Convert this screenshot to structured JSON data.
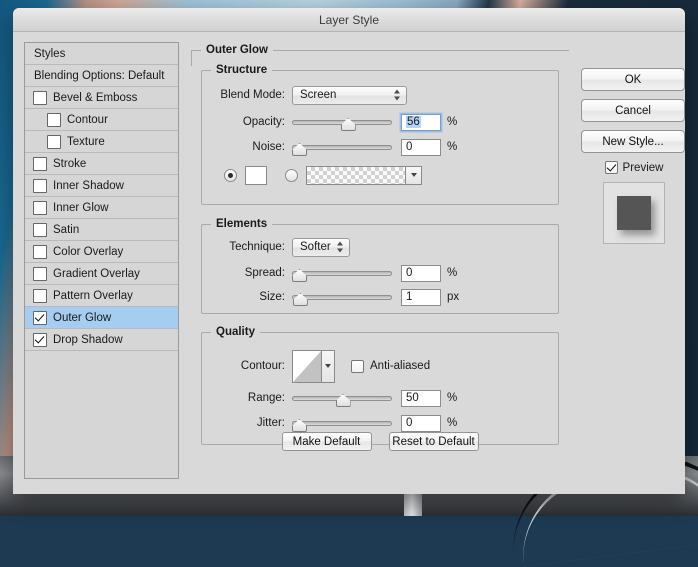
{
  "window": {
    "title": "Layer Style"
  },
  "styles_panel": {
    "header_label": "Styles",
    "blending_options_label": "Blending Options: Default",
    "items": [
      {
        "label": "Bevel & Emboss",
        "checked": false,
        "indent": false,
        "selected": false
      },
      {
        "label": "Contour",
        "checked": false,
        "indent": true,
        "selected": false
      },
      {
        "label": "Texture",
        "checked": false,
        "indent": true,
        "selected": false
      },
      {
        "label": "Stroke",
        "checked": false,
        "indent": false,
        "selected": false
      },
      {
        "label": "Inner Shadow",
        "checked": false,
        "indent": false,
        "selected": false
      },
      {
        "label": "Inner Glow",
        "checked": false,
        "indent": false,
        "selected": false
      },
      {
        "label": "Satin",
        "checked": false,
        "indent": false,
        "selected": false
      },
      {
        "label": "Color Overlay",
        "checked": false,
        "indent": false,
        "selected": false
      },
      {
        "label": "Gradient Overlay",
        "checked": false,
        "indent": false,
        "selected": false
      },
      {
        "label": "Pattern Overlay",
        "checked": false,
        "indent": false,
        "selected": false
      },
      {
        "label": "Outer Glow",
        "checked": true,
        "indent": false,
        "selected": true
      },
      {
        "label": "Drop Shadow",
        "checked": true,
        "indent": false,
        "selected": false
      }
    ]
  },
  "main_panel": {
    "effect_title": "Outer Glow",
    "structure": {
      "legend": "Structure",
      "blend_mode_label": "Blend Mode:",
      "blend_mode_value": "Screen",
      "opacity_label": "Opacity:",
      "opacity_value": "56",
      "opacity_unit": "%",
      "noise_label": "Noise:",
      "noise_value": "0",
      "noise_unit": "%",
      "fill_type": "color",
      "color_value": "#ffffff"
    },
    "elements": {
      "legend": "Elements",
      "technique_label": "Technique:",
      "technique_value": "Softer",
      "spread_label": "Spread:",
      "spread_value": "0",
      "spread_unit": "%",
      "size_label": "Size:",
      "size_value": "1",
      "size_unit": "px"
    },
    "quality": {
      "legend": "Quality",
      "contour_label": "Contour:",
      "anti_aliased_label": "Anti-aliased",
      "anti_aliased_checked": false,
      "range_label": "Range:",
      "range_value": "50",
      "range_unit": "%",
      "jitter_label": "Jitter:",
      "jitter_value": "0",
      "jitter_unit": "%"
    },
    "make_default_label": "Make Default",
    "reset_to_default_label": "Reset to Default"
  },
  "right_panel": {
    "ok_label": "OK",
    "cancel_label": "Cancel",
    "new_style_label": "New Style...",
    "preview_label": "Preview",
    "preview_checked": true,
    "preview_swatch_color": "#555555"
  },
  "sliders": {
    "opacity_pct": 56,
    "noise_pct": 0,
    "spread_pct": 0,
    "size_pct": 1,
    "range_pct": 50,
    "jitter_pct": 0
  }
}
